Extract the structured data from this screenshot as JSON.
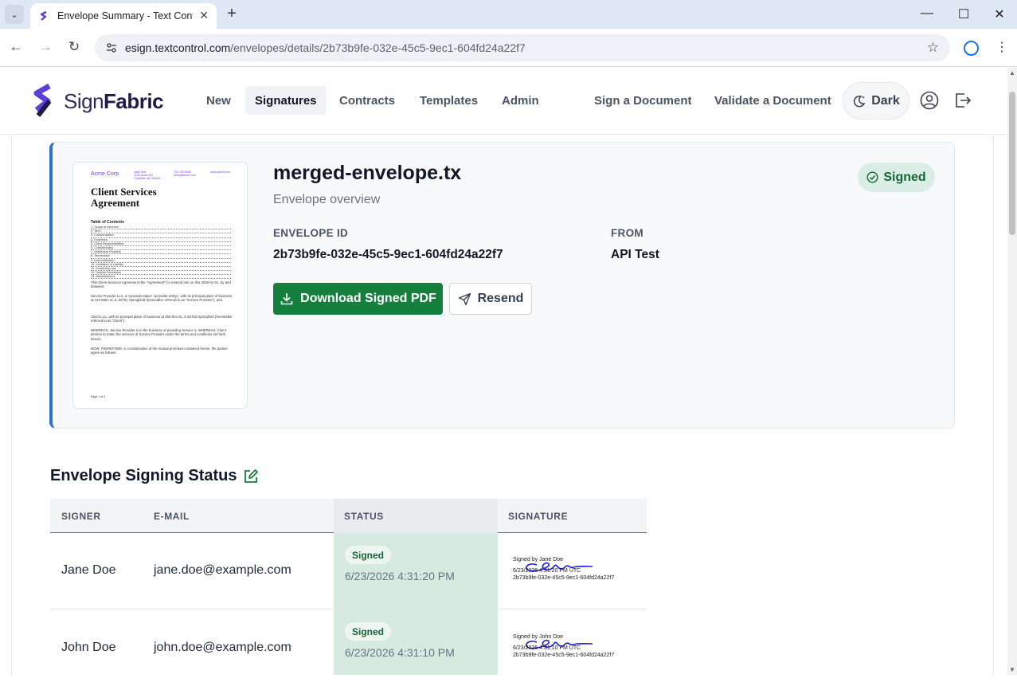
{
  "browser": {
    "tab_title": "Envelope Summary - Text Contr",
    "url_host": "esign.textcontrol.com",
    "url_path": "/envelopes/details/2b73b9fe-032e-45c5-9ec1-604fd24a22f7"
  },
  "header": {
    "logo_light": "Sign",
    "logo_bold": "Fabric",
    "nav": [
      "New",
      "Signatures",
      "Contracts",
      "Templates",
      "Admin"
    ],
    "nav_right": [
      "Sign a Document",
      "Validate a Document"
    ],
    "dark_label": "Dark"
  },
  "thumbnail": {
    "company": "Acme Corp",
    "addr1": "Jane Doe",
    "addr2": "1234 Acme Rd",
    "addr3": "Charlotte, NC 28208",
    "phone": "704.700.5000",
    "email": "hello@acme.com",
    "web": "www.acme.com",
    "title_line1": "Client Services",
    "title_line2": "Agreement",
    "toc_heading": "Table of Contents",
    "toc": [
      "1. Scope of Services",
      "2. Term",
      "3. Compensation",
      "4. Expenses",
      "5. Client Responsibilities",
      "6. Confidentiality",
      "7. Intellectual Property",
      "8. Termination",
      "9. Indemnification",
      "10. Limitation of Liability",
      "11. Governing Law",
      "12. Dispute Resolution",
      "13. Miscellaneous"
    ],
    "para1": "This Client Services Agreement (the \"Agreement\") is entered into on this 2026-01-01, by and between:",
    "para2": "Service Provider LLC, a <provider.state> <provider.entity>, with its principal place of business at 123 Main St, IL 62701 Springfield (hereinafter referred to as \"Service Provider\"), and",
    "para3": "Client LLC, with its principal place of business at 456 Elm St, IL 62702 Springfield (hereinafter referred to as \"Client\").",
    "para4": "WHEREAS, Service Provider is in the business of providing Service 1; WHEREAS, Client desires to retain the services of Service Provider under the terms and conditions set forth herein;",
    "para5": "NOW, THEREFORE, in consideration of the mutual promises contained herein, the parties agree as follows:",
    "page": "Page 1 of 4"
  },
  "envelope": {
    "title": "merged-envelope.tx",
    "subtitle": "Envelope overview",
    "status": "Signed",
    "id_label": "ENVELOPE ID",
    "id_value": "2b73b9fe-032e-45c5-9ec1-604fd24a22f7",
    "from_label": "FROM",
    "from_value": "API Test",
    "download_label": "Download Signed PDF",
    "resend_label": "Resend"
  },
  "signing": {
    "title": "Envelope Signing Status",
    "columns": [
      "SIGNER",
      "E-MAIL",
      "STATUS",
      "SIGNATURE"
    ],
    "rows": [
      {
        "signer": "Jane Doe",
        "email": "jane.doe@example.com",
        "status": "Signed",
        "date": "6/23/2026 4:31:20 PM",
        "sig_line1": "Signed by Jane Doe",
        "sig_line2": "6/23/2026 4:31:20 PM UTC",
        "sig_line3": "2b73b9fe-032e-45c5-9ec1-604fd24a22f7"
      },
      {
        "signer": "John Doe",
        "email": "john.doe@example.com",
        "status": "Signed",
        "date": "6/23/2026 4:31:10 PM",
        "sig_line1": "Signed by John Doe",
        "sig_line2": "6/23/2026 4:31:10 PM UTC",
        "sig_line3": "2b73b9fe-032e-45c5-9ec1-604fd24a22f7"
      }
    ]
  },
  "colors": {
    "accent": "#2f6fd6",
    "download_bg": "#15803d",
    "signed_bg": "#dbeee5",
    "signed_text": "#166534",
    "status_col": "#d6eadf",
    "logo_purple": "#7c3aed"
  }
}
